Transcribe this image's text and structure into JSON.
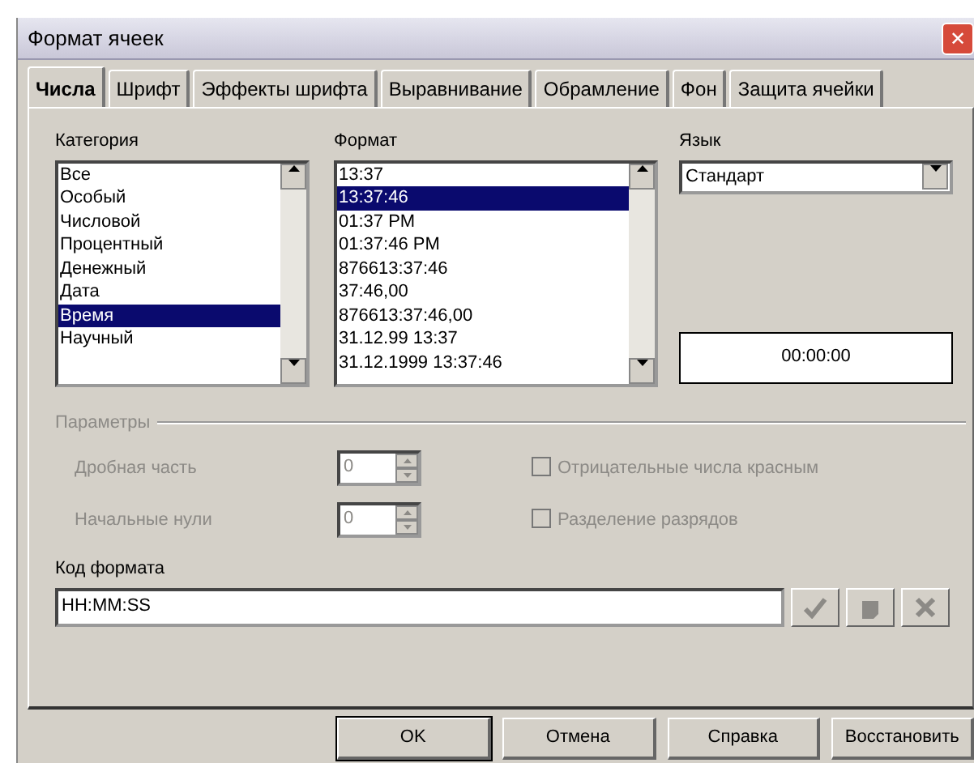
{
  "window": {
    "title": "Формат ячеек",
    "close": "✕"
  },
  "tabs": [
    {
      "label": "Числа",
      "selected": true
    },
    {
      "label": "Шрифт",
      "selected": false
    },
    {
      "label": "Эффекты шрифта",
      "selected": false
    },
    {
      "label": "Выравнивание",
      "selected": false
    },
    {
      "label": "Обрамление",
      "selected": false
    },
    {
      "label": "Фон",
      "selected": false
    },
    {
      "label": "Защита ячейки",
      "selected": false
    }
  ],
  "category": {
    "label": "Категория",
    "items": [
      {
        "label": "Все",
        "selected": false
      },
      {
        "label": "Особый",
        "selected": false
      },
      {
        "label": "Числовой",
        "selected": false
      },
      {
        "label": "Процентный",
        "selected": false
      },
      {
        "label": "Денежный",
        "selected": false
      },
      {
        "label": "Дата",
        "selected": false
      },
      {
        "label": "Время",
        "selected": true
      },
      {
        "label": "Научный",
        "selected": false
      }
    ]
  },
  "format": {
    "label": "Формат",
    "items": [
      {
        "label": "13:37",
        "selected": false
      },
      {
        "label": "13:37:46",
        "selected": true
      },
      {
        "label": "01:37 PM",
        "selected": false
      },
      {
        "label": "01:37:46 PM",
        "selected": false
      },
      {
        "label": "876613:37:46",
        "selected": false
      },
      {
        "label": "37:46,00",
        "selected": false
      },
      {
        "label": "876613:37:46,00",
        "selected": false
      },
      {
        "label": "31.12.99 13:37",
        "selected": false
      },
      {
        "label": "31.12.1999 13:37:46",
        "selected": false
      }
    ]
  },
  "language": {
    "label": "Язык",
    "value": "Стандарт"
  },
  "preview": "00:00:00",
  "options": {
    "title": "Параметры",
    "disabled": true,
    "spins": [
      {
        "label": "Дробная часть",
        "value": "0"
      },
      {
        "label": "Начальные нули",
        "value": "0"
      }
    ],
    "checks": [
      {
        "label": "Отрицательные числа красным",
        "checked": false
      },
      {
        "label": "Разделение разрядов",
        "checked": false
      }
    ]
  },
  "format_code": {
    "label": "Код формата",
    "value": "HH:MM:SS"
  },
  "buttons": [
    {
      "label": "OK",
      "default": true
    },
    {
      "label": "Отмена",
      "default": false
    },
    {
      "label": "Справка",
      "default": false
    },
    {
      "label": "Восстановить",
      "default": false
    }
  ]
}
